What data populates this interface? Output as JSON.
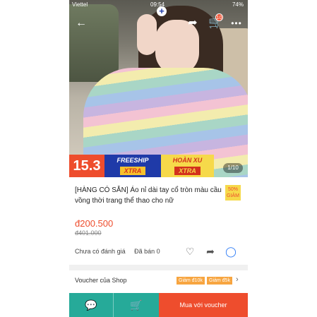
{
  "status_bar": {
    "carrier": "Viettel",
    "time": "09:54",
    "battery": "74%"
  },
  "nav": {
    "back_icon": "back-arrow-icon",
    "share_icon": "share-icon",
    "cart_icon": "cart-icon",
    "cart_count": "10",
    "more_icon": "more-icon"
  },
  "promo": {
    "date": "15.3",
    "freeship_line1": "FREESHIP",
    "freeship_line2": "XTRA",
    "plus": "+",
    "xu_line1": "HOÀN XU",
    "xu_line2": "XTRA"
  },
  "gallery": {
    "indicator": "1/10"
  },
  "product": {
    "title": "[HÀNG CÓ SẴN] Áo nỉ dài tay cổ tròn màu cầu vồng thời trang thể thao cho nữ",
    "discount_badge": "50% GIẢM",
    "price": "đ200.500",
    "old_price": "đ401.000",
    "rating_text": "Chưa có đánh giá",
    "sold_text": "Đã bán 0"
  },
  "actions": {
    "heart_icon": "heart-icon",
    "share_icon": "share-icon",
    "messenger_icon": "messenger-icon"
  },
  "voucher": {
    "label": "Voucher của Shop",
    "tags": [
      "Giảm đ10k",
      "Giảm đ5k"
    ]
  },
  "bottom_bar": {
    "chat_icon": "chat-icon",
    "cart_icon": "add-to-cart-icon",
    "buy_label": "Mua với voucher"
  },
  "colors": {
    "accent": "#ee4d2d",
    "teal": "#26aa99",
    "promo_blue": "#1f3aa8",
    "promo_yellow": "#f6d94a"
  }
}
